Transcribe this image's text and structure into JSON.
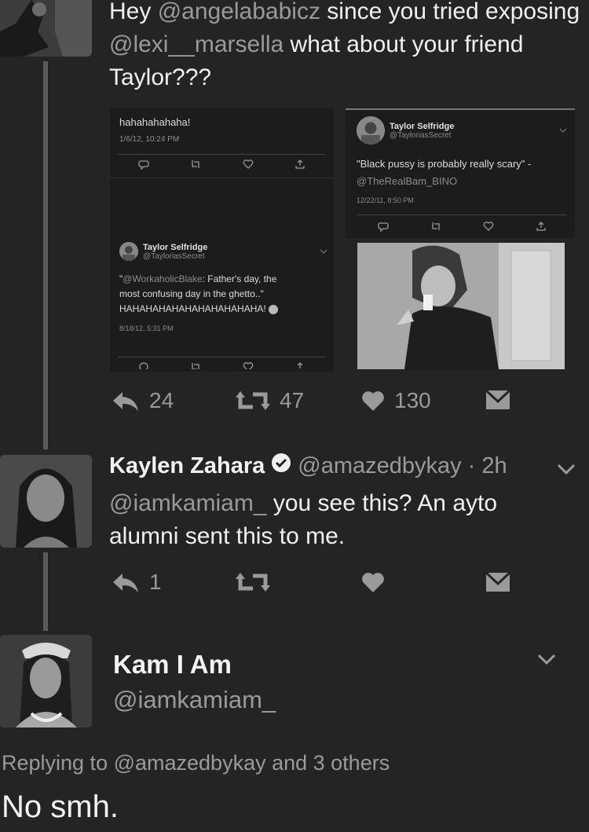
{
  "tweet1": {
    "text_prefix": "Hey ",
    "mention1": "@angelababicz",
    "text_mid1": " since you tried exposing ",
    "mention2": "@lexi__marsella",
    "text_mid2": " what about your friend Taylor???",
    "actions": {
      "reply_count": "24",
      "retweet_count": "47",
      "like_count": "130"
    }
  },
  "embedded": {
    "left_top": {
      "text": "hahahahahaha!",
      "timestamp": "1/6/12, 10:24 PM"
    },
    "left_bottom": {
      "name": "Taylor Selfridge",
      "handle": "@TayloriasSecret",
      "quote_open": "\"",
      "mention": "@WorkaholicBlake",
      "text_line1": ": Father's day, the",
      "text_line2": "most confusing day in the ghetto..\"",
      "text_line3": "HAHAHAHAHAHAHAHAHAHAHA!",
      "timestamp": "8/18/12, 5:31 PM"
    },
    "right_top": {
      "name": "Taylor Selfridge",
      "handle": "@TayloriasSecret",
      "text_line1": "\"Black pussy is probably really scary\" -",
      "mention": "@TheRealBam_BINO",
      "timestamp": "12/22/11, 8:50 PM"
    }
  },
  "tweet2": {
    "name": "Kaylen Zahara",
    "handle": "@amazedbykay",
    "time": "· 2h",
    "mention": "@iamkamiam_",
    "text_line1": " you see this? An ayto",
    "text_line2": "alumni sent this to me.",
    "actions": {
      "reply_count": "1"
    }
  },
  "tweet3": {
    "name": "Kam I Am",
    "handle": "@iamkamiam_",
    "replying_prefix": "Replying to ",
    "replying_mention": "@amazedbykay",
    "replying_suffix": " and 3 others",
    "text": "No smh."
  },
  "colors": {
    "background": "#242424",
    "text": "#f0f0f0",
    "muted": "#9a9a9a"
  },
  "icons": [
    "reply-icon",
    "retweet-icon",
    "like-icon",
    "dm-icon",
    "chevron-down-icon",
    "verified-badge-icon"
  ]
}
